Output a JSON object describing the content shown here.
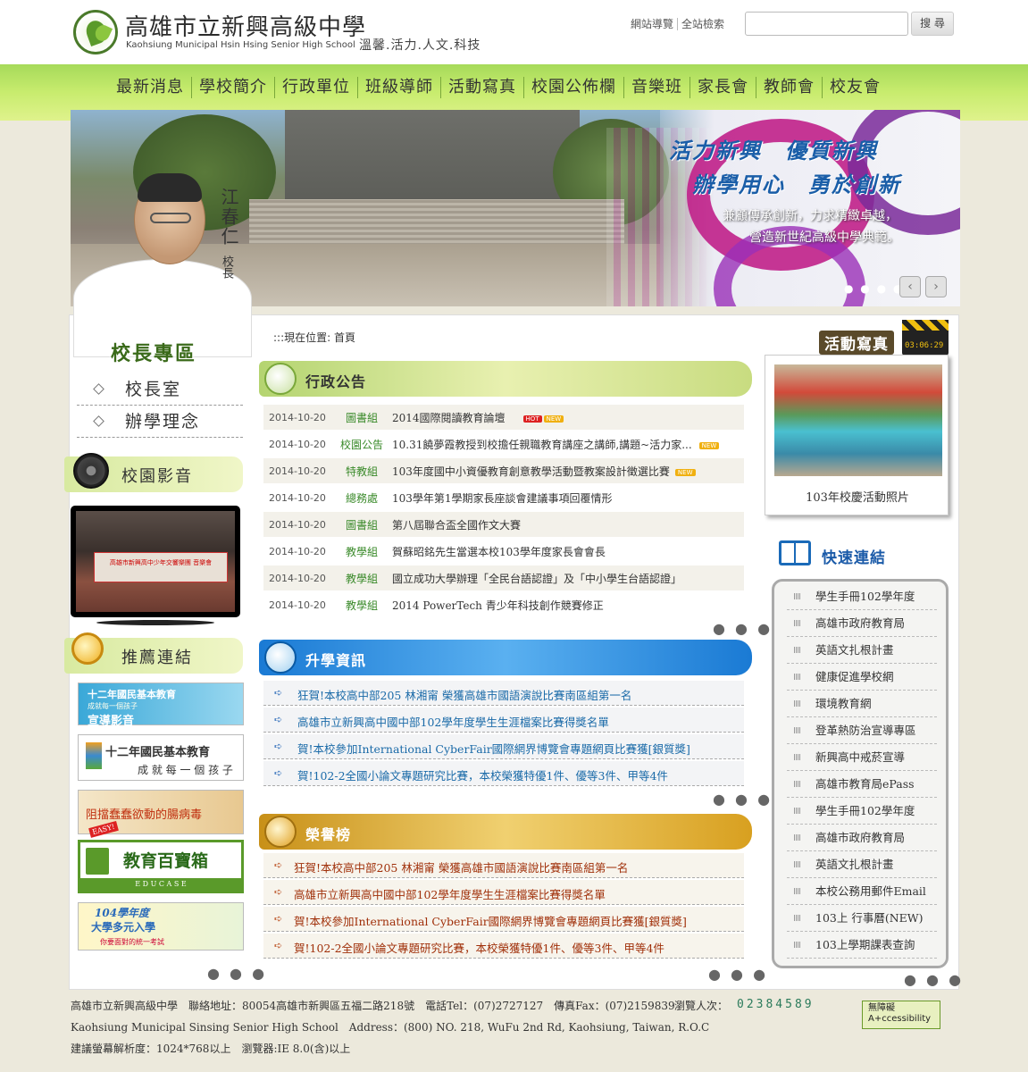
{
  "header": {
    "school_name_zh": "高雄市立新興高級中學",
    "school_name_en": "Kaohsiung Municipal Hsin Hsing Senior High School",
    "motto": "溫馨.活力.人文.科技",
    "links": [
      "網站導覽",
      "全站檢索"
    ],
    "search_placeholder": "",
    "search_button": "搜 尋"
  },
  "nav": {
    "items": [
      "最新消息",
      "學校簡介",
      "行政單位",
      "班級導師",
      "活動寫真",
      "校園公佈欄",
      "音樂班",
      "家長會",
      "教師會",
      "校友會"
    ]
  },
  "banner": {
    "slogan_line1": "活力新興　優質新興",
    "slogan_line2": "辦學用心　勇於創新",
    "slogan_line3": "兼顧傳承創新，力求精緻卓越，",
    "slogan_line4": "營造新世紀高級中學典範。",
    "dots": "● ● ● ●",
    "prev": "‹",
    "next": "›"
  },
  "principal": {
    "name": "江春仁",
    "title": "校長",
    "zone_label": "校長專區",
    "menu": [
      "校長室",
      "辦學理念"
    ]
  },
  "sidebar": {
    "video_title": "校園影音",
    "video_banner": "高雄市新興高中少年交響樂團 音樂會",
    "links_title": "推薦連結",
    "ad1_line1": "十二年國民基本教育",
    "ad1_line2": "成就每一個孩子",
    "ad1_line3": "宣導影音",
    "ad2_line1": "十二年國民基本教育",
    "ad2_line2": "成 就 每 一 個 孩 子",
    "ad3_text": "阻擋蠢蠢欲動的腸病毒",
    "ad3_badge": "EASY!",
    "ad4_text": "教育百寶箱",
    "ad4_sub": "E D U C A S E",
    "ad5_line1": "104學年度",
    "ad5_line2": "大學多元入學",
    "ad5_line3": "你要面對的統一考試"
  },
  "location": ":::現在位置: 首頁",
  "admin": {
    "title": "行政公告",
    "rows": [
      {
        "date": "2014-10-20",
        "dept": "圖書組",
        "title": "2014國際閱讀教育論壇",
        "hot": "HOT",
        "new": "NEW"
      },
      {
        "date": "2014-10-20",
        "dept": "校園公告",
        "title": "10.31饒夢霞教授到校擔任親職教育講座之講師,講題~活力家...",
        "hot": "",
        "new": "NEW"
      },
      {
        "date": "2014-10-20",
        "dept": "特教組",
        "title": "103年度國中小資優教育創意教學活動暨教案設計徵選比賽",
        "hot": "",
        "new": "NEW"
      },
      {
        "date": "2014-10-20",
        "dept": "總務處",
        "title": "103學年第1學期家長座談會建議事項回覆情形",
        "hot": "",
        "new": ""
      },
      {
        "date": "2014-10-20",
        "dept": "圖書組",
        "title": "第八屆聯合盃全國作文大賽",
        "hot": "",
        "new": ""
      },
      {
        "date": "2014-10-20",
        "dept": "教學組",
        "title": "賀蘇昭銘先生當選本校103學年度家長會會長",
        "hot": "",
        "new": ""
      },
      {
        "date": "2014-10-20",
        "dept": "教學組",
        "title": "國立成功大學辦理「全民台語認證」及「中小學生台語認證」",
        "hot": "",
        "new": ""
      },
      {
        "date": "2014-10-20",
        "dept": "教學組",
        "title": "2014 PowerTech 青少年科技創作競賽修正",
        "hot": "",
        "new": ""
      }
    ],
    "more": "● ● ●"
  },
  "study": {
    "title": "升學資訊",
    "rows": [
      "狂賀!本校高中部205 林湘甯 榮獲高雄市國語演說比賽南區組第一名",
      "高雄市立新興高中國中部102學年度學生生涯檔案比賽得獎名單",
      "賀!本校參加International CyberFair國際網界博覽會專題網頁比賽獲[銀質獎]",
      "賀!102-2全國小論文專題研究比賽，本校榮獲特優1件、優等3件、甲等4件"
    ],
    "arrow": "➪",
    "more": "● ● ●"
  },
  "honor": {
    "title": "榮譽榜",
    "rows": [
      "狂賀!本校高中部205 林湘甯 榮獲高雄市國語演說比賽南區組第一名",
      "高雄市立新興高中國中部102學年度學生生涯檔案比賽得獎名單",
      "賀!本校參加International CyberFair國際網界博覽會專題網頁比賽獲[銀質獎]",
      "賀!102-2全國小論文專題研究比賽，本校榮獲特優1件、優等3件、甲等4件"
    ],
    "arrow": "➪",
    "more": "● ● ●"
  },
  "activity": {
    "title": "活動寫真",
    "clock": "03:06:29",
    "caption": "103年校慶活動照片"
  },
  "quick": {
    "title": "快速連結",
    "items": [
      "學生手冊102學年度",
      "高雄市政府教育局",
      "英語文扎根計畫",
      "健康促進學校網",
      "環境教育網",
      "登革熱防治宣導專區",
      "新興高中戒菸宣導",
      "高雄市教育局ePass",
      "學生手冊102學年度",
      "高雄市政府教育局",
      "英語文扎根計畫",
      "本校公務用郵件Email",
      "103上 行事曆(NEW)",
      "103上學期課表查詢"
    ],
    "more": "● ● ●"
  },
  "footer": {
    "line1": "高雄市立新興高級中學　聯絡地址：80054高雄市新興區五福二路218號　電話Tel：(07)2727127　傳真Fax：(07)2159839",
    "counter_label": "瀏覽人次：",
    "counter": "02384589",
    "line2": "Kaohsiung Municipal Sinsing Senior High School　Address：(800) NO. 218, WuFu 2nd Rd, Kaohsiung, Taiwan, R.O.C",
    "line3": "建議螢幕解析度：1024*768以上　瀏覽器:IE 8.0(含)以上",
    "a11y_line1": "無障礙",
    "a11y_line2": "A+ccessibility"
  },
  "more_left_video": "● ● ●"
}
